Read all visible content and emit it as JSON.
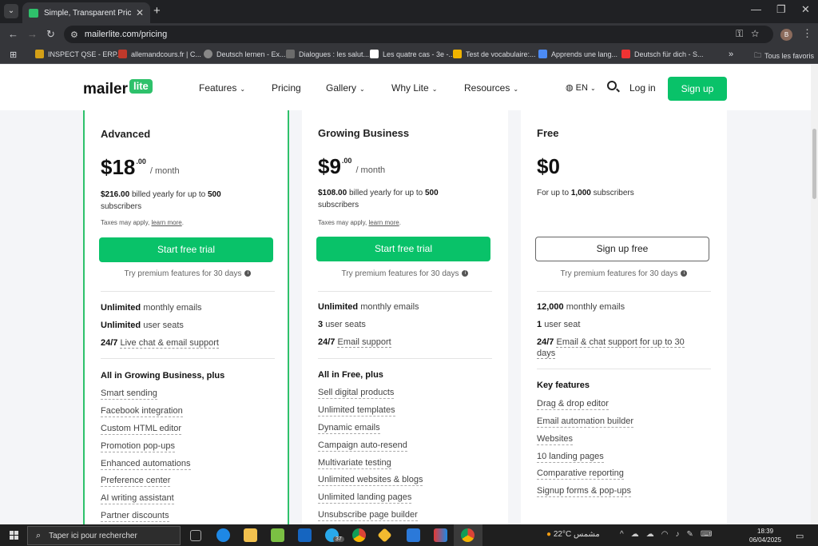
{
  "browser": {
    "tab_title": "Simple, Transparent Pricing - M",
    "url": "mailerlite.com/pricing",
    "profile_initial": "B",
    "bookmarks": [
      {
        "label": "INSPECT QSE - ERP...",
        "color": "#d4a017"
      },
      {
        "label": "allemandcours.fr | C...",
        "color": "#c0392b"
      },
      {
        "label": "Deutsch lernen - Ex...",
        "color": "#888888"
      },
      {
        "label": "Dialogues : les salut...",
        "color": "#6b6b6b"
      },
      {
        "label": "Les quatre cas - 3e -...",
        "color": "#ffffff"
      },
      {
        "label": "Test de vocabulaire:...",
        "color": "#f0b400"
      },
      {
        "label": "Apprends une lang...",
        "color": "#4c8bf5"
      },
      {
        "label": "Deutsch für dich - S...",
        "color": "#ee3333"
      }
    ],
    "all_bookmarks": "Tous les favoris"
  },
  "site": {
    "logo_main": "mailer",
    "logo_badge": "lite",
    "nav": {
      "features": "Features",
      "pricing": "Pricing",
      "gallery": "Gallery",
      "why_lite": "Why Lite",
      "resources": "Resources"
    },
    "language": "EN",
    "login": "Log in",
    "signup": "Sign up"
  },
  "plans": [
    {
      "name": "Advanced",
      "price": "$18",
      "cents": ".00",
      "period": "/ month",
      "billed_amount": "$216.00",
      "billed_text": "billed yearly for up to",
      "billed_count": "500",
      "billed_unit": "subscribers",
      "tax": "Taxes may apply,",
      "tax_link": "learn more",
      "cta": "Start free trial",
      "trial": "Try premium features for 30 days",
      "features": [
        {
          "bold": "Unlimited",
          "text": "monthly emails"
        },
        {
          "bold": "Unlimited",
          "text": "user seats"
        },
        {
          "bold": "24/7",
          "text": "Live chat & email support"
        }
      ],
      "section": "All in Growing Business, plus",
      "items": [
        "Smart sending",
        "Facebook integration",
        "Custom HTML editor",
        "Promotion pop-ups",
        "Enhanced automations",
        "Preference center",
        "AI writing assistant",
        "Partner discounts"
      ]
    },
    {
      "name": "Growing Business",
      "price": "$9",
      "cents": ".00",
      "period": "/ month",
      "billed_amount": "$108.00",
      "billed_text": "billed yearly for up to",
      "billed_count": "500",
      "billed_unit": "subscribers",
      "tax": "Taxes may apply,",
      "tax_link": "learn more",
      "cta": "Start free trial",
      "trial": "Try premium features for 30 days",
      "features": [
        {
          "bold": "Unlimited",
          "text": "monthly emails"
        },
        {
          "bold": "3",
          "text": "user seats"
        },
        {
          "bold": "24/7",
          "text": "Email support"
        }
      ],
      "section": "All in Free, plus",
      "items": [
        "Sell digital products",
        "Unlimited templates",
        "Dynamic emails",
        "Campaign auto-resend",
        "Multivariate testing",
        "Unlimited websites & blogs",
        "Unlimited landing pages",
        "Unsubscribe page builder"
      ]
    },
    {
      "name": "Free",
      "price": "$0",
      "for_text": "For up to",
      "for_count": "1,000",
      "for_unit": "subscribers",
      "cta": "Sign up free",
      "trial": "Try premium features for 30 days",
      "features": [
        {
          "bold": "12,000",
          "text": "monthly emails"
        },
        {
          "bold": "1",
          "text": "user seat"
        },
        {
          "bold": "24/7",
          "text": "Email & chat support for up to 30 days"
        }
      ],
      "section": "Key features",
      "items": [
        "Drag & drop editor",
        "Email automation builder",
        "Websites",
        "10 landing pages",
        "Comparative reporting",
        "Signup forms & pop-ups"
      ]
    }
  ],
  "taskbar": {
    "search_placeholder": "Taper ici pour rechercher",
    "telegram_badge": "37",
    "weather_temp": "22°C",
    "weather_text": "مشمس",
    "time": "18:39",
    "date": "06/04/2025"
  }
}
